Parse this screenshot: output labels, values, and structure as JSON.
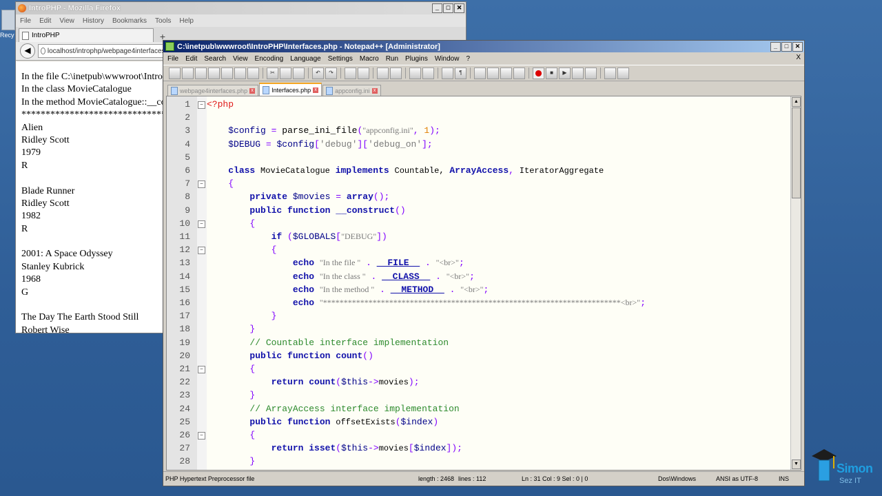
{
  "desktop": {
    "icon_label": "Recy"
  },
  "firefox": {
    "title": "IntroPHP - Mozilla Firefox",
    "menu": [
      "File",
      "Edit",
      "View",
      "History",
      "Bookmarks",
      "Tools",
      "Help"
    ],
    "tab_label": "IntroPHP",
    "url": "localhost/introphp/webpage4interfaces.php",
    "content_lines": [
      "In the file C:\\inetpub\\wwwroot\\IntroP",
      "In the class MovieCatalogue",
      "In the method MovieCatalogue::__cor",
      "******************************",
      "Alien",
      "Ridley Scott",
      "1979",
      "R",
      "",
      "Blade Runner",
      "Ridley Scott",
      "1982",
      "R",
      "",
      "2001: A Space Odyssey",
      "Stanley Kubrick",
      "1968",
      "G",
      "",
      "The Day The Earth Stood Still",
      "Robert Wise"
    ]
  },
  "notepad": {
    "title": "C:\\inetpub\\wwwroot\\IntroPHP\\Interfaces.php - Notepad++ [Administrator]",
    "menu": [
      "File",
      "Edit",
      "Search",
      "View",
      "Encoding",
      "Language",
      "Settings",
      "Macro",
      "Run",
      "Plugins",
      "Window",
      "?"
    ],
    "close_menu": "X",
    "tabs": [
      {
        "label": "webpage4interfaces.php",
        "active": false
      },
      {
        "label": "Interfaces.php",
        "active": true
      },
      {
        "label": "appconfig.ini",
        "active": false
      }
    ],
    "line_numbers": [
      "1",
      "2",
      "3",
      "4",
      "5",
      "6",
      "7",
      "8",
      "9",
      "10",
      "11",
      "12",
      "13",
      "14",
      "15",
      "16",
      "17",
      "18",
      "19",
      "20",
      "21",
      "22",
      "23",
      "24",
      "25",
      "26",
      "27",
      "28"
    ],
    "status": {
      "filetype": "PHP Hypertext Preprocessor file",
      "length": "length : 2468",
      "lines": "lines : 112",
      "position": "Ln : 31   Col : 9   Sel : 0 | 0",
      "eol": "Dos\\Windows",
      "encoding": "ANSI as UTF-8",
      "mode": "INS"
    }
  },
  "logo": {
    "text": "Simon",
    "sub": "Sez IT"
  },
  "colors": {
    "keyword": "#1111aa",
    "comment": "#2d8a2d",
    "php_tag": "#e01a1a",
    "titlebar": "#0a246a"
  }
}
